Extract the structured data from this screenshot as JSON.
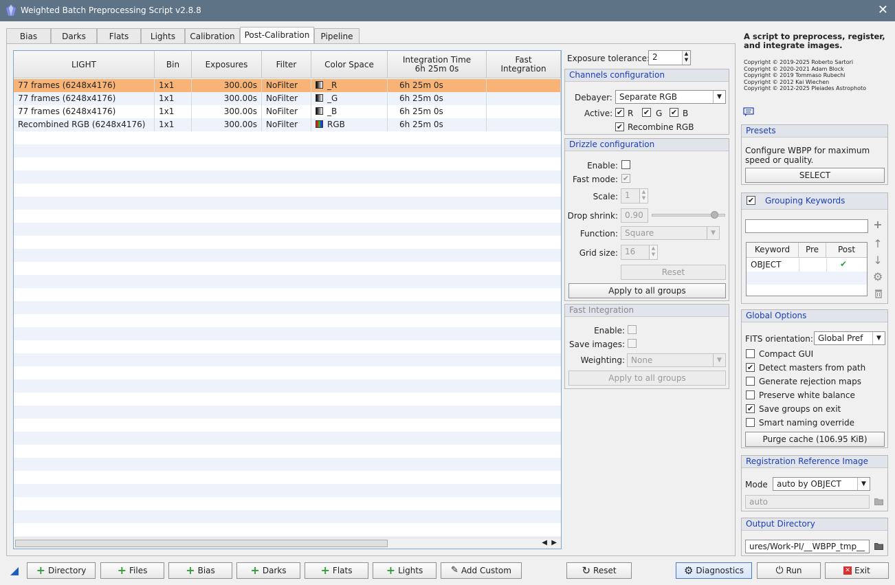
{
  "window": {
    "title": "Weighted Batch Preprocessing Script v2.8.8",
    "close": "✕"
  },
  "tabs": [
    "Bias",
    "Darks",
    "Flats",
    "Lights",
    "Calibration",
    "Post-Calibration",
    "Pipeline"
  ],
  "active_tab": "Post-Calibration",
  "table": {
    "columns": [
      "LIGHT",
      "Bin",
      "Exposures",
      "Filter",
      "Color Space",
      "Integration Time\n6h 25m  0s",
      "Fast\nIntegration"
    ],
    "rows": [
      {
        "light": "77 frames (6248x4176)",
        "bin": "1x1",
        "exposures": "300.00s",
        "filter": "NoFilter",
        "color_space": "_R",
        "integration": "6h 25m  0s",
        "fast": "",
        "swatch": "r",
        "selected": true
      },
      {
        "light": "77 frames (6248x4176)",
        "bin": "1x1",
        "exposures": "300.00s",
        "filter": "NoFilter",
        "color_space": "_G",
        "integration": "6h 25m  0s",
        "fast": "",
        "swatch": "g",
        "selected": false
      },
      {
        "light": "77 frames (6248x4176)",
        "bin": "1x1",
        "exposures": "300.00s",
        "filter": "NoFilter",
        "color_space": "_B",
        "integration": "6h 25m  0s",
        "fast": "",
        "swatch": "b",
        "selected": false
      },
      {
        "light": "Recombined RGB (6248x4176)",
        "bin": "1x1",
        "exposures": "300.00s",
        "filter": "NoFilter",
        "color_space": "RGB",
        "integration": "6h 25m  0s",
        "fast": "",
        "swatch": "rgb",
        "selected": false
      }
    ],
    "scroll_left": "◀",
    "scroll_right": "▶"
  },
  "exposure_tolerance": {
    "label": "Exposure tolerance:",
    "value": "2"
  },
  "channels": {
    "title": "Channels configuration",
    "debayer_label": "Debayer:",
    "debayer_value": "Separate RGB",
    "active_label": "Active:",
    "r": "R",
    "g": "G",
    "b": "B",
    "r_checked": true,
    "g_checked": true,
    "b_checked": true,
    "recombine": "Recombine RGB",
    "recombine_checked": true
  },
  "drizzle": {
    "title": "Drizzle configuration",
    "enable_label": "Enable:",
    "enable_checked": false,
    "fast_label": "Fast mode:",
    "fast_checked": true,
    "scale_label": "Scale:",
    "scale_value": "1",
    "shrink_label": "Drop shrink:",
    "shrink_value": "0.90",
    "function_label": "Function:",
    "function_value": "Square",
    "grid_label": "Grid size:",
    "grid_value": "16",
    "reset": "Reset",
    "apply": "Apply to all groups"
  },
  "fast_integration": {
    "title": "Fast Integration",
    "enable_label": "Enable:",
    "enable_checked": false,
    "save_label": "Save images:",
    "save_checked": false,
    "weighting_label": "Weighting:",
    "weighting_value": "None",
    "apply": "Apply to all groups"
  },
  "info": {
    "heading": "A script to preprocess, register, and integrate images.",
    "copyright": [
      "Copyright © 2019-2025 Roberto Sartori",
      "Copyright © 2020-2021 Adam Block",
      "Copyright © 2019 Tommaso Rubechi",
      "Copyright © 2012 Kai Wiechen",
      "Copyright © 2012-2025 Pleiades Astrophoto"
    ]
  },
  "presets": {
    "title": "Presets",
    "text": "Configure WBPP for maximum speed or quality.",
    "button": "SELECT"
  },
  "grouping": {
    "title": "Grouping Keywords",
    "checked": true,
    "input": "",
    "columns": [
      "Keyword",
      "Pre",
      "Post"
    ],
    "rows": [
      {
        "keyword": "OBJECT",
        "pre": "",
        "post": "✔"
      }
    ]
  },
  "global": {
    "title": "Global Options",
    "fits_label": "FITS orientation:",
    "fits_value": "Global Pref",
    "options": [
      {
        "label": "Compact GUI",
        "checked": false
      },
      {
        "label": "Detect masters from path",
        "checked": true
      },
      {
        "label": "Generate rejection maps",
        "checked": false
      },
      {
        "label": "Preserve white balance",
        "checked": false
      },
      {
        "label": "Save groups on exit",
        "checked": true
      },
      {
        "label": "Smart naming override",
        "checked": false
      }
    ],
    "purge": "Purge cache (106.95 KiB)"
  },
  "registration": {
    "title": "Registration Reference Image",
    "mode_label": "Mode",
    "mode_value": "auto by OBJECT",
    "path": "auto"
  },
  "output": {
    "title": "Output Directory",
    "path": "ures/Work-PI/__WBPP_tmp__"
  },
  "bottom": {
    "directory": "Directory",
    "files": "Files",
    "bias": "Bias",
    "darks": "Darks",
    "flats": "Flats",
    "lights": "Lights",
    "add_custom": "Add Custom",
    "reset": "Reset",
    "diagnostics": "Diagnostics",
    "run": "Run",
    "exit": "Exit"
  },
  "colors": {
    "accent": "#1a3eb8",
    "selected_row": "#f7b476",
    "title_bar": "#5f7387",
    "plus": "#2f9e3a"
  }
}
